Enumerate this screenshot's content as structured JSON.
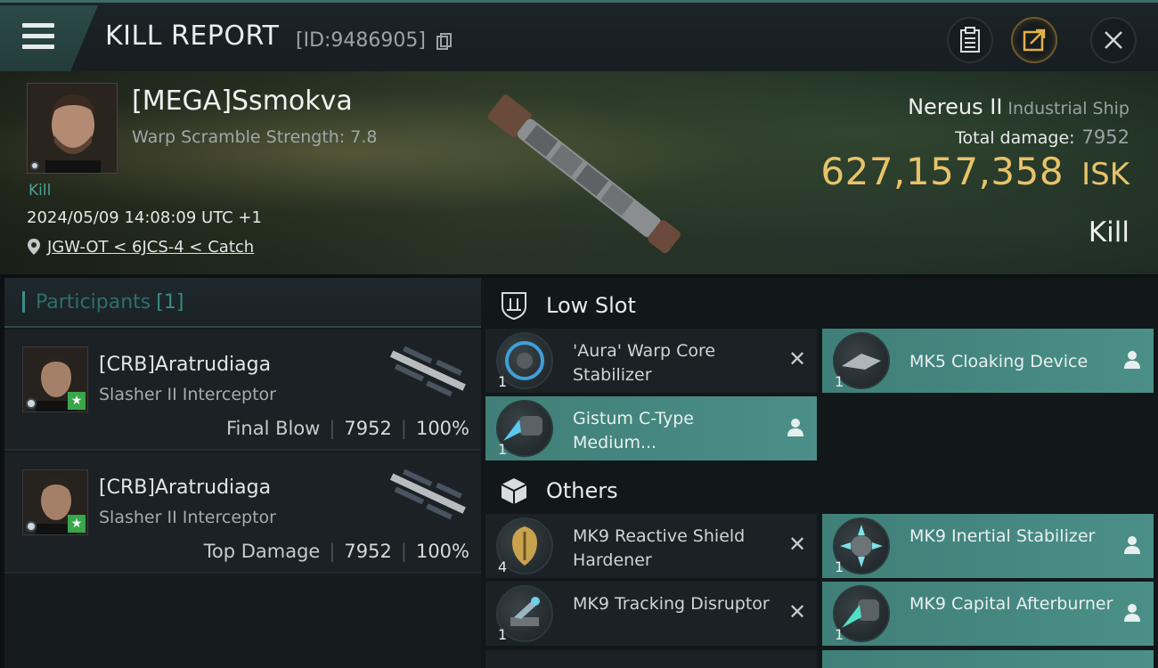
{
  "header": {
    "title": "KILL REPORT",
    "id_text": "[ID:9486905]"
  },
  "victim": {
    "name": "[MEGA]Ssmokva",
    "warp_scramble": "Warp Scramble Strength: 7.8",
    "kill_tag": "Kill",
    "datetime": "2024/05/09 14:08:09 UTC +1",
    "location": "JGW-OT < 6JCS-4 < Catch",
    "ship_name": "Nereus II",
    "ship_class": "Industrial Ship",
    "total_damage_label": "Total damage:",
    "total_damage": "7952",
    "isk_value": "627,157,358",
    "isk_unit": "ISK",
    "result": "Kill"
  },
  "participants": {
    "title": "Participants",
    "count": "[1]",
    "items": [
      {
        "name": "[CRB]Aratrudiaga",
        "ship": "Slasher II Interceptor",
        "role": "Final Blow",
        "damage": "7952",
        "percent": "100%"
      },
      {
        "name": "[CRB]Aratrudiaga",
        "ship": "Slasher II Interceptor",
        "role": "Top Damage",
        "damage": "7952",
        "percent": "100%"
      }
    ]
  },
  "sections": {
    "low_slot": {
      "title": "Low Slot",
      "modules": [
        {
          "name": "'Aura' Warp Core Stabilizer",
          "qty": "1"
        },
        {
          "name": "MK5 Cloaking Device",
          "qty": "1"
        },
        {
          "name": "Gistum C-Type Medium...",
          "qty": "1"
        }
      ]
    },
    "others": {
      "title": "Others",
      "modules": [
        {
          "name": "MK9 Reactive Shield Hardener",
          "qty": "4"
        },
        {
          "name": "MK9 Inertial Stabilizer",
          "qty": "1"
        },
        {
          "name": "MK9 Tracking Disruptor",
          "qty": "1"
        },
        {
          "name": "MK9 Capital Afterburner",
          "qty": "1"
        }
      ]
    }
  },
  "colors": {
    "accent_teal": "#4b8f88",
    "isk_gold": "#e8c36a",
    "kill_tag": "#4fa09a"
  }
}
